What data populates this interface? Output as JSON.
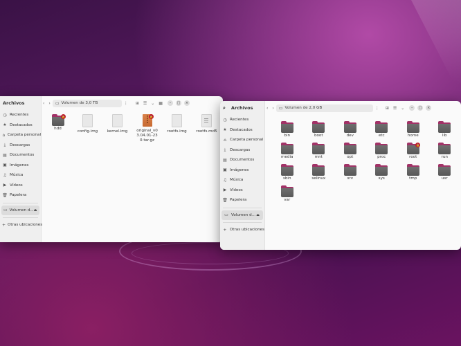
{
  "left_window": {
    "app_title": "Archivos",
    "path": "Volumen de 3,0 TB",
    "sidebar": [
      {
        "icon": "clock-icon",
        "label": "Recientes"
      },
      {
        "icon": "star-icon",
        "label": "Destacados"
      },
      {
        "icon": "home-icon",
        "label": "Carpeta personal"
      },
      {
        "icon": "download-icon",
        "label": "Descargas"
      },
      {
        "icon": "document-icon",
        "label": "Documentos"
      },
      {
        "icon": "image-icon",
        "label": "Imágenes"
      },
      {
        "icon": "music-icon",
        "label": "Música"
      },
      {
        "icon": "video-icon",
        "label": "Vídeos"
      },
      {
        "icon": "trash-icon",
        "label": "Papelera"
      },
      {
        "icon": "drive-icon",
        "label": "Volumen d..."
      },
      {
        "icon": "plus-icon",
        "label": "Otras ubicaciones"
      }
    ],
    "files": [
      {
        "name": "hdd",
        "type": "folder",
        "locked": true
      },
      {
        "name": "config.img",
        "type": "file",
        "locked": false
      },
      {
        "name": "kernel.img",
        "type": "file",
        "locked": false
      },
      {
        "name": "original_v03.04.01-230.tar.gz",
        "type": "archive",
        "locked": true
      },
      {
        "name": "rootfs.img",
        "type": "file",
        "locked": false
      },
      {
        "name": "rootfs.md5",
        "type": "text",
        "locked": false
      }
    ]
  },
  "right_window": {
    "app_title": "Archivos",
    "path": "Volumen de 2,0 GB",
    "sidebar": [
      {
        "icon": "clock-icon",
        "label": "Recientes"
      },
      {
        "icon": "star-icon",
        "label": "Destacados"
      },
      {
        "icon": "home-icon",
        "label": "Carpeta personal"
      },
      {
        "icon": "download-icon",
        "label": "Descargas"
      },
      {
        "icon": "document-icon",
        "label": "Documentos"
      },
      {
        "icon": "image-icon",
        "label": "Imágenes"
      },
      {
        "icon": "music-icon",
        "label": "Música"
      },
      {
        "icon": "video-icon",
        "label": "Vídeos"
      },
      {
        "icon": "trash-icon",
        "label": "Papelera"
      },
      {
        "icon": "drive-icon",
        "label": "Volumen d..."
      },
      {
        "icon": "plus-icon",
        "label": "Otras ubicaciones"
      }
    ],
    "folders": [
      {
        "name": "bin",
        "locked": false
      },
      {
        "name": "boot",
        "locked": false
      },
      {
        "name": "dev",
        "locked": false
      },
      {
        "name": "etc",
        "locked": false
      },
      {
        "name": "home",
        "locked": false
      },
      {
        "name": "lib",
        "locked": false
      },
      {
        "name": "media",
        "locked": false
      },
      {
        "name": "mnt",
        "locked": false
      },
      {
        "name": "opt",
        "locked": false
      },
      {
        "name": "proc",
        "locked": false
      },
      {
        "name": "root",
        "locked": true
      },
      {
        "name": "run",
        "locked": false
      },
      {
        "name": "sbin",
        "locked": false
      },
      {
        "name": "selinux",
        "locked": false
      },
      {
        "name": "srv",
        "locked": false
      },
      {
        "name": "sys",
        "locked": false
      },
      {
        "name": "tmp",
        "locked": false
      },
      {
        "name": "usr",
        "locked": false
      },
      {
        "name": "var",
        "locked": false
      }
    ]
  },
  "colors": {
    "folder_accent": "#a23267",
    "lock_badge": "#c01c28"
  }
}
